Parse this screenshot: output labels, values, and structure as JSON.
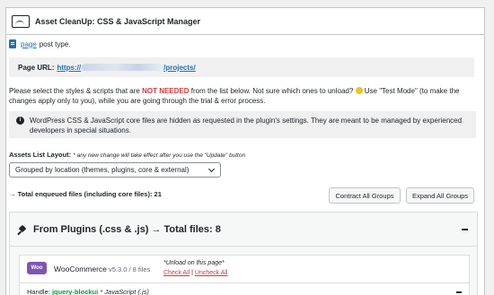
{
  "header": {
    "title": "Asset CleanUp: CSS & JavaScript Manager",
    "icon": "gauge-icon"
  },
  "post_type": {
    "link": "page",
    "suffix": "post type."
  },
  "page_url": {
    "label": "Page URL:",
    "prefix": "https://",
    "suffix": "/projects/"
  },
  "instructions": {
    "part1": "Please select the styles & scripts that are ",
    "highlight": "NOT NEEDED",
    "part2": " from the list below. Not sure which ones to unload? ",
    "part3": " Use \"Test Mode\" (to make the changes apply only to you), while you are going through the trial & error process."
  },
  "notice": {
    "icon": "info-icon",
    "text": "WordPress CSS & JavaScript core files are hidden as requested in the plugin's settings. They are meant to be managed by experienced developers in special situations."
  },
  "assets_layout": {
    "label": "Assets List Layout:",
    "note": "* any new change will take effect after you use the \"Update\" button",
    "selected": "Grouped by location (themes, plugins, core & external)"
  },
  "total_files": "→ Total enqueued files (including core files): 21",
  "buttons": {
    "contract": "Contract All Groups",
    "expand": "Expand All Groups"
  },
  "plugins_group": {
    "title": "From Plugins (.css & .js) → Total files: 8",
    "plugin": {
      "logo": "Woo",
      "name": "WooCommerce",
      "version": " v5.3.0 / 8 files",
      "unload_note": "*Unload on this page*",
      "check_all": "Check All",
      "separator": " | ",
      "uncheck_all": "Uncheck All",
      "handle_label": "Handle: ",
      "handle_name": "jquery-blockui",
      "handle_type": " * JavaScript (.js)"
    }
  }
}
